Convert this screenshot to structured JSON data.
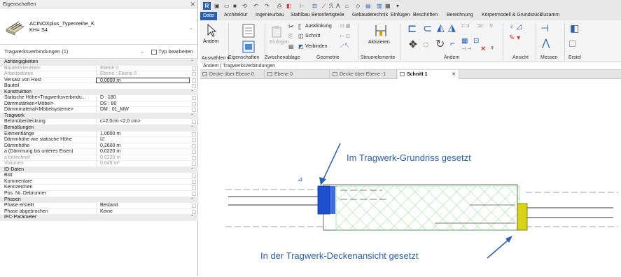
{
  "properties": {
    "title": "Eigenschaften",
    "type_name_line1": "ACINOXplus_Typenreihe_K",
    "type_name_line2": "KH= S4",
    "filter_label": "Tragwerksverbindungen (1)",
    "edit_type_label": "Typ bearbeiten",
    "rows": [
      {
        "k": "Abhängigkeiten",
        "v": "",
        "kind": "sec"
      },
      {
        "k": "Bauteilisteneben",
        "v": "Ebene 0",
        "kind": "dis"
      },
      {
        "k": "Arbeitsebene",
        "v": "Ebene : Ebene 0",
        "kind": "dis"
      },
      {
        "k": "Versatz von Host",
        "v": "0,0000 m",
        "kind": "edit"
      },
      {
        "k": "Bauteil",
        "v": "",
        "kind": "norm"
      },
      {
        "k": "Konstruktion",
        "v": "",
        "kind": "sec"
      },
      {
        "k": "Statische Höhe<Tragwerksverbindu...",
        "v": "D : 180",
        "kind": "norm"
      },
      {
        "k": "Dämmstärken<Möbel>",
        "v": "DS : 80",
        "kind": "norm"
      },
      {
        "k": "Dämmmaterial<Möbelsysteme>",
        "v": "DM : 01_MW",
        "kind": "norm"
      },
      {
        "k": "Tragwerk",
        "v": "",
        "kind": "sec"
      },
      {
        "k": "Betonüberdeckung",
        "v": "c=2.0cm <2,0 cm>",
        "kind": "norm"
      },
      {
        "k": "Bemaßungen",
        "v": "",
        "kind": "sec"
      },
      {
        "k": "Elementlänge",
        "v": "1,0000 m",
        "kind": "norm"
      },
      {
        "k": "Dämmhöhe wie statische Höhe",
        "v": "☑",
        "kind": "norm"
      },
      {
        "k": "Dämmhöhe",
        "v": "0,2600 m",
        "kind": "norm"
      },
      {
        "k": "a (Dämmung bis unteres Eisen)",
        "v": "0,0220 m",
        "kind": "norm"
      },
      {
        "k": "a berechnet",
        "v": "0,0220 m",
        "kind": "dis"
      },
      {
        "k": "Volumen",
        "v": "0,049 m³",
        "kind": "dis"
      },
      {
        "k": "ID-Daten",
        "v": "",
        "kind": "sec"
      },
      {
        "k": "Bild",
        "v": "",
        "kind": "norm"
      },
      {
        "k": "Kommentare",
        "v": "",
        "kind": "norm"
      },
      {
        "k": "Kennzeichen",
        "v": "",
        "kind": "norm"
      },
      {
        "k": "Pos. Nr. Debrunner",
        "v": "",
        "kind": "norm"
      },
      {
        "k": "Phasen",
        "v": "",
        "kind": "sec"
      },
      {
        "k": "Phase erstellt",
        "v": "Bestand",
        "kind": "norm"
      },
      {
        "k": "Phase abgebrochen",
        "v": "Keine",
        "kind": "norm"
      },
      {
        "k": "IFC-Parameter",
        "v": "",
        "kind": "sec"
      }
    ]
  },
  "menu": [
    "Datei",
    "Architektur",
    "Ingenieurbau",
    "Stahlbau",
    "Betonfertigteile",
    "Gebäudetechnik",
    "Einfügen",
    "Beschriften",
    "Berechnung",
    "Körpermodell & Grundstück",
    "Zusamm"
  ],
  "ribbon": {
    "modify": "Ändern",
    "paste": "Einfügen",
    "cut_notch": "Ausklinkung",
    "cut": "Schnitt",
    "connect": "Verbinden",
    "activate": "Aktivieren",
    "groups": [
      "Auswählen ▾",
      "Eigenschaften",
      "Zwischenablage",
      "Geometrie",
      "Steuerelemente",
      "Ändern",
      "Ansicht",
      "Messen",
      "Erstel"
    ]
  },
  "context_bar": "Ändern | Tragwerksverbindungen",
  "tabs": [
    {
      "label": "Decke über Ebene 0",
      "active": false
    },
    {
      "label": "Ebene 0",
      "active": false
    },
    {
      "label": "Decke über Ebene -1",
      "active": false
    },
    {
      "label": "Schnitt 1",
      "active": true
    }
  ],
  "annotations": {
    "top": "Im Tragwerk-Grundriss gesetzt",
    "bottom": "In der Tragwerk-Deckenansicht gesetzt"
  },
  "colors": {
    "accent": "#2a5fb0",
    "annotation": "#2a5fb0",
    "hatch": "#5fd35f",
    "connector_left": "#1f4fcf",
    "connector_right": "#d9d31a"
  }
}
